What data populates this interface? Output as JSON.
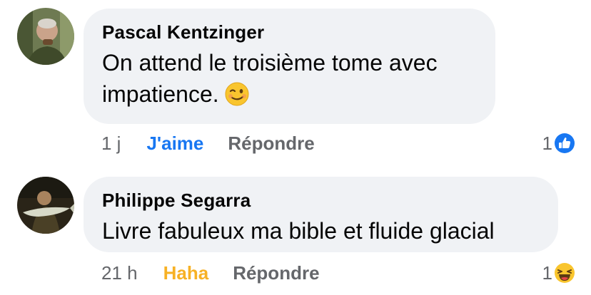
{
  "comments": [
    {
      "author": "Pascal Kentzinger",
      "text_line1": "On attend le troisième tome avec",
      "text_line2": "impatience.",
      "text_emoji": "winking-face-emoji",
      "time": "1 j",
      "reaction_label": "J'aime",
      "reply_label": "Répondre",
      "reaction_count": "1",
      "reaction_icon": "like-icon",
      "reaction_color": "#1877f2"
    },
    {
      "author": "Philippe Segarra",
      "text": "Livre fabuleux ma bible et fluide glacial",
      "time": "21 h",
      "reaction_label": "Haha",
      "reply_label": "Répondre",
      "reaction_count": "1",
      "reaction_icon": "haha-icon",
      "reaction_color": "#f7b125"
    }
  ]
}
